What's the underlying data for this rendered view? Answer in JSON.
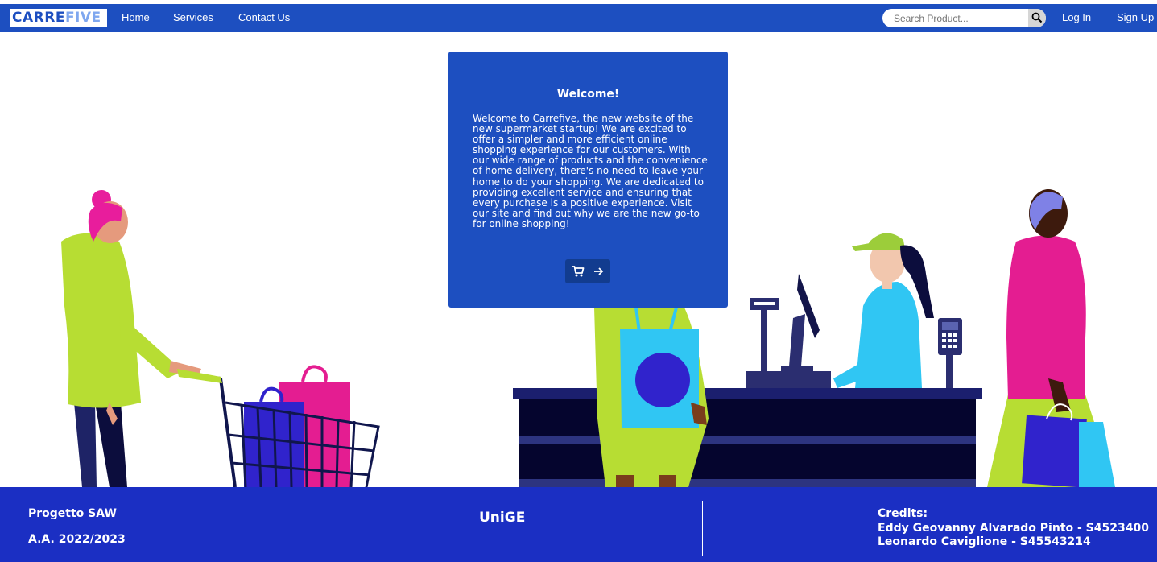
{
  "nav": {
    "logo_left": "CARRE",
    "logo_right": "FIVE",
    "links": [
      "Home",
      "Services",
      "Contact Us"
    ],
    "search_placeholder": "Search Product...",
    "login": "Log In",
    "signup": "Sign Up"
  },
  "welcome": {
    "title": "Welcome!",
    "body": "Welcome to Carrefive, the new website of the new supermarket startup! We are excited to offer a simpler and more efficient online shopping experience for our customers. With our wide range of products and the convenience of home delivery, there's no need to leave your home to do your shopping. We are dedicated to providing excellent service and ensuring that every purchase is a positive experience. Visit our site and find out why we are the new go-to for online shopping!"
  },
  "footer": {
    "project": "Progetto SAW",
    "year": "A.A. 2022/2023",
    "university": "UniGE",
    "credits_title": "Credits:",
    "credit_1": "Eddy Geovanny Alvarado Pinto - S4523400",
    "credit_2": "Leonardo Caviglione - S45543214"
  },
  "colors": {
    "primary": "#1d4fc0",
    "footer": "#1b2fc3",
    "button_dark": "#123c8f"
  },
  "icons": [
    "search-icon",
    "cart-icon",
    "arrow-right-icon"
  ]
}
